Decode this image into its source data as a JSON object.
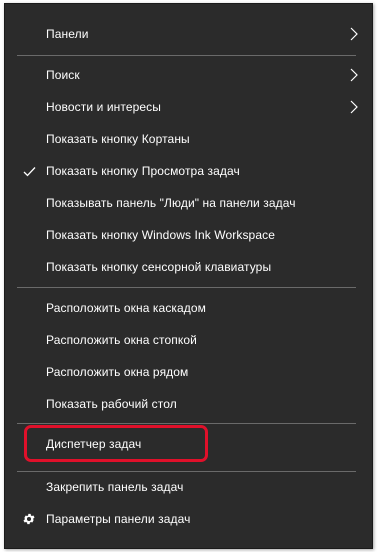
{
  "menu": {
    "items": [
      {
        "label": "Панели",
        "submenu": true
      },
      {
        "label": "Поиск",
        "submenu": true
      },
      {
        "label": "Новости и интересы",
        "submenu": true
      },
      {
        "label": "Показать кнопку Кортаны"
      },
      {
        "label": "Показать кнопку Просмотра задач",
        "checked": true,
        "lead_icon": "checkmark-icon"
      },
      {
        "label": "Показывать панель \"Люди\" на панели задач"
      },
      {
        "label": "Показать кнопку Windows Ink Workspace"
      },
      {
        "label": "Показать кнопку сенсорной клавиатуры"
      },
      {
        "label": "Расположить окна каскадом"
      },
      {
        "label": "Расположить окна стопкой"
      },
      {
        "label": "Расположить окна рядом"
      },
      {
        "label": "Показать рабочий стол"
      },
      {
        "label": "Диспетчер задач",
        "highlighted": true
      },
      {
        "label": "Закрепить панель задач"
      },
      {
        "label": "Параметры панели задач",
        "lead_icon": "gear-icon"
      }
    ]
  },
  "colors": {
    "menu_background": "#2b2b2b",
    "text": "#ffffff",
    "separator": "#6a6a6a",
    "highlight_outline": "#e0102a"
  },
  "icons": {
    "submenu": "chevron-right-icon",
    "check": "checkmark-icon",
    "settings": "gear-icon"
  }
}
